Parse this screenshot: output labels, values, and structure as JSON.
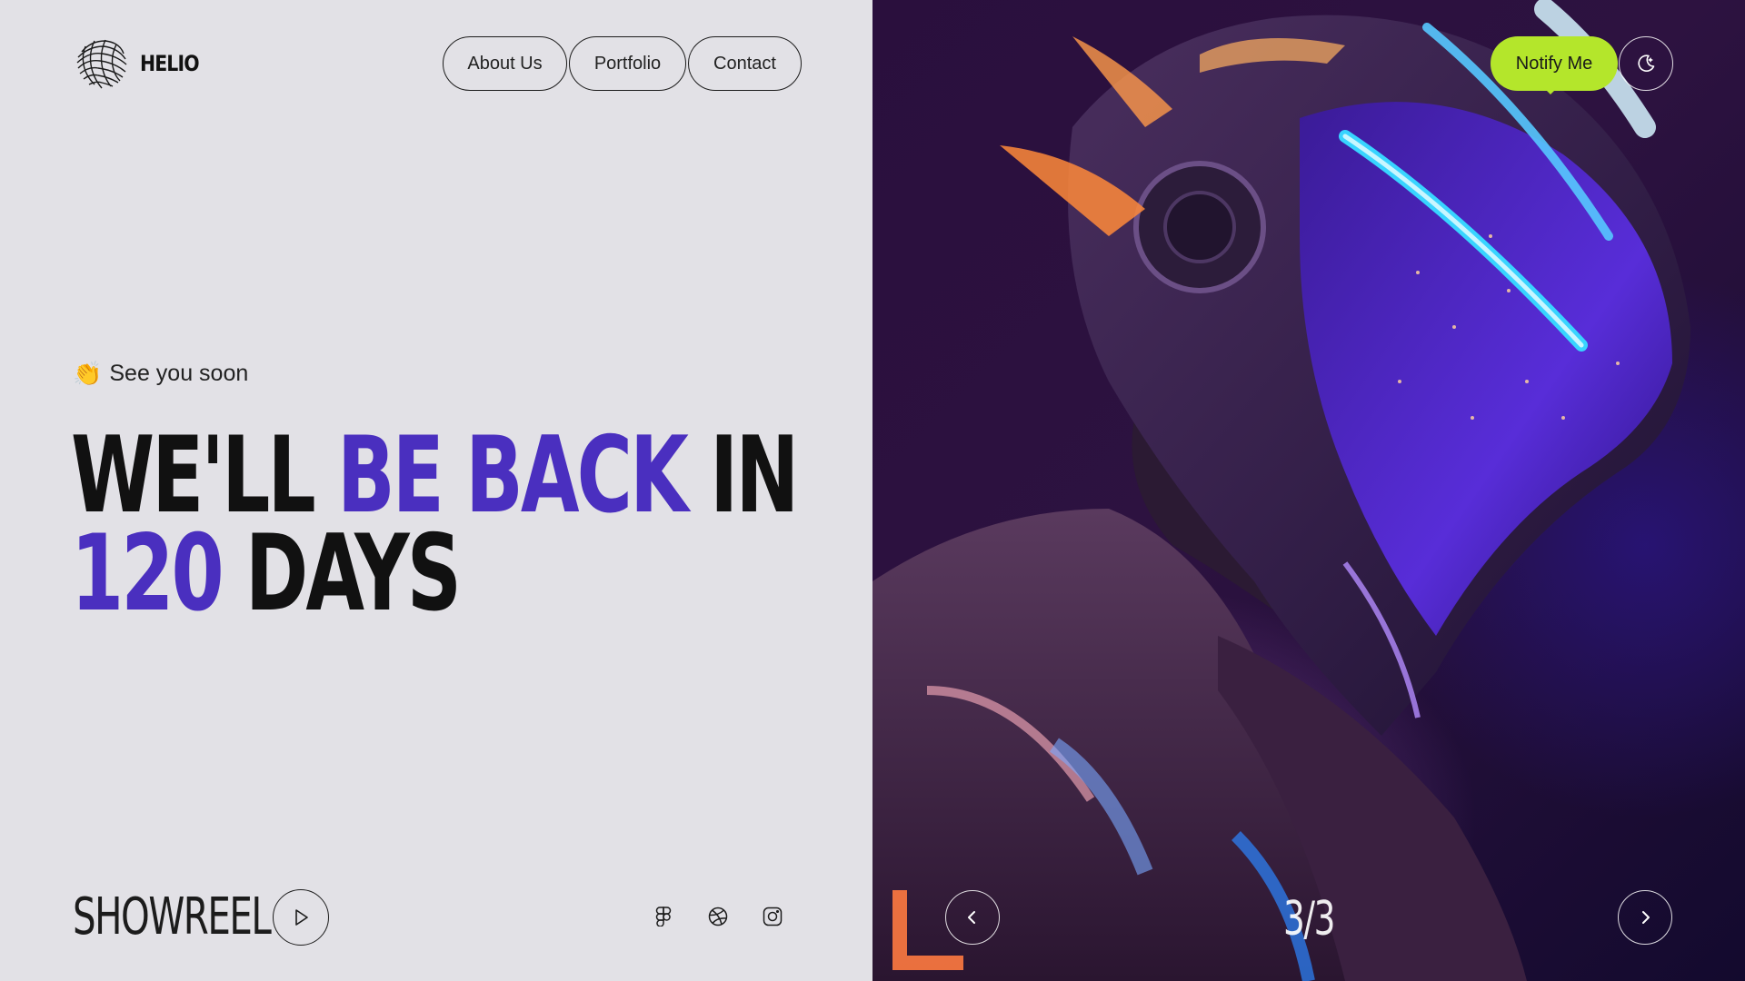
{
  "brand": {
    "name": "HELIO",
    "logo_icon": "wavy-sphere-icon"
  },
  "nav": {
    "items": [
      {
        "label": "About Us"
      },
      {
        "label": "Portfolio"
      },
      {
        "label": "Contact"
      }
    ]
  },
  "hero": {
    "tagline_emoji": "👏",
    "tagline": "See you soon",
    "headline_line1": {
      "part1": "WE'LL ",
      "accent": "BE BACK",
      "part2": " IN"
    },
    "headline_line2": {
      "accent": "120",
      "part2": " DAYS"
    },
    "accent_color": "#4a2fbf"
  },
  "showreel": {
    "label": "SHOWREEL",
    "play_icon": "play-icon"
  },
  "socials": [
    {
      "icon": "figma-icon"
    },
    {
      "icon": "dribbble-icon"
    },
    {
      "icon": "instagram-icon"
    }
  ],
  "header_right": {
    "notify_label": "Notify Me",
    "notify_color": "#b4e62b",
    "theme_icon": "moon-icon"
  },
  "slider": {
    "counter": "3/3",
    "prev_icon": "chevron-left-icon",
    "next_icon": "chevron-right-icon"
  }
}
